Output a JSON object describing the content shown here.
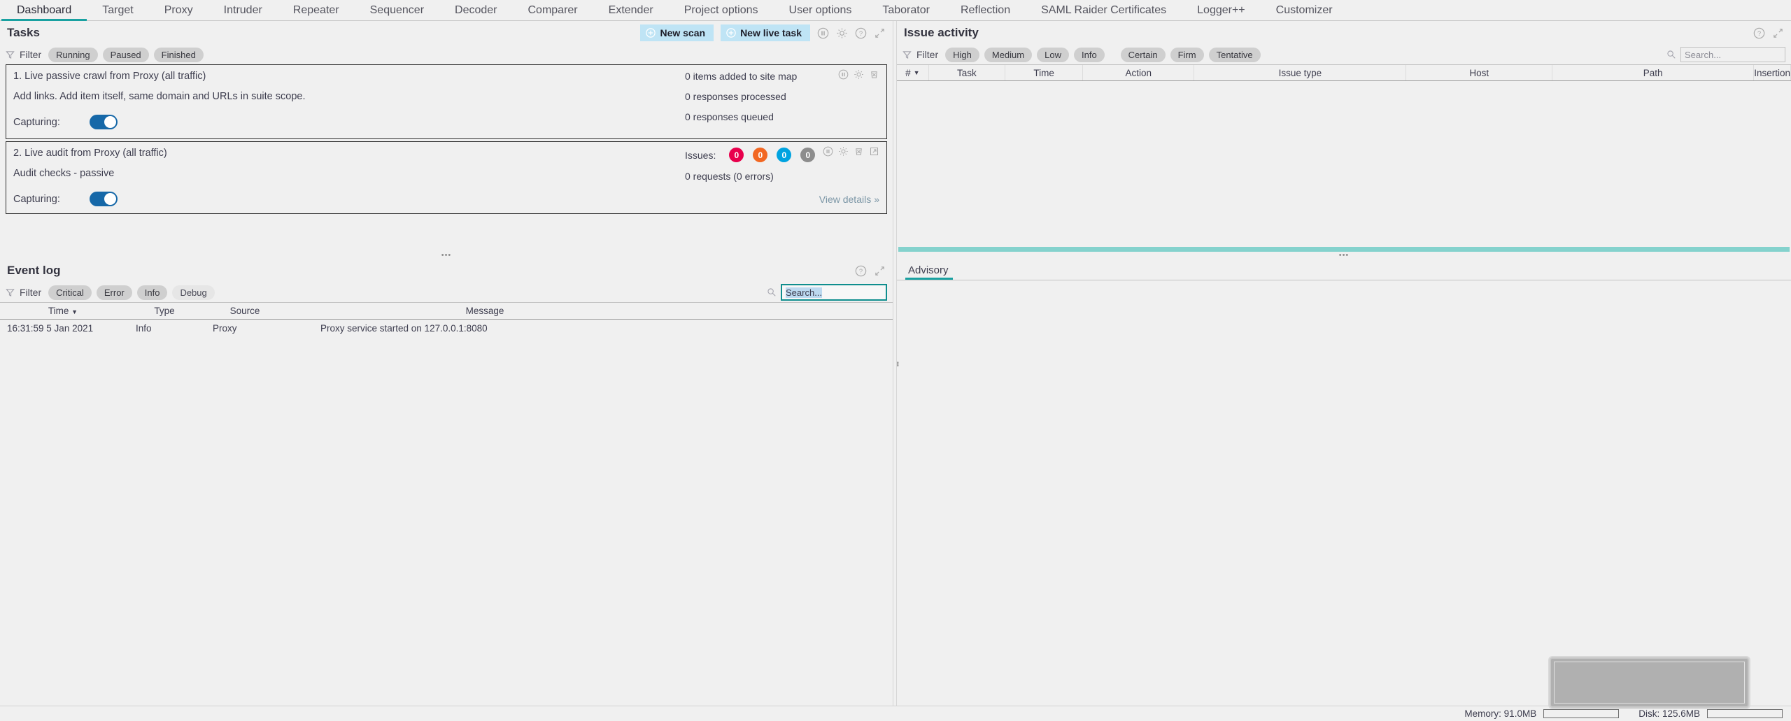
{
  "nav": {
    "tabs": [
      {
        "label": "Dashboard",
        "active": true
      },
      {
        "label": "Target",
        "active": false
      },
      {
        "label": "Proxy",
        "active": false
      },
      {
        "label": "Intruder",
        "active": false
      },
      {
        "label": "Repeater",
        "active": false
      },
      {
        "label": "Sequencer",
        "active": false
      },
      {
        "label": "Decoder",
        "active": false
      },
      {
        "label": "Comparer",
        "active": false
      },
      {
        "label": "Extender",
        "active": false
      },
      {
        "label": "Project options",
        "active": false
      },
      {
        "label": "User options",
        "active": false
      },
      {
        "label": "Taborator",
        "active": false
      },
      {
        "label": "Reflection",
        "active": false
      },
      {
        "label": "SAML Raider Certificates",
        "active": false
      },
      {
        "label": "Logger++",
        "active": false
      },
      {
        "label": "Customizer",
        "active": false
      }
    ]
  },
  "tasks": {
    "title": "Tasks",
    "new_scan_label": "New scan",
    "new_live_task_label": "New live task",
    "filter_label": "Filter",
    "filter_chips": [
      {
        "label": "Running",
        "on": true
      },
      {
        "label": "Paused",
        "on": true
      },
      {
        "label": "Finished",
        "on": true
      }
    ],
    "items": [
      {
        "title": "1. Live passive crawl from Proxy (all traffic)",
        "description": "Add links. Add item itself, same domain and URLs in suite scope.",
        "capturing_label": "Capturing:",
        "capturing_on": true,
        "stats": [
          "0 items added to site map",
          "0 responses processed",
          "0 responses queued"
        ],
        "icons": [
          "pause-icon",
          "gear-icon",
          "trash-icon"
        ],
        "has_issues": false,
        "has_view_details": false
      },
      {
        "title": "2. Live audit from Proxy (all traffic)",
        "description": "Audit checks - passive",
        "capturing_label": "Capturing:",
        "capturing_on": true,
        "issues_label": "Issues:",
        "issue_badges": [
          {
            "count": "0",
            "color": "#e8004c",
            "severity": "high"
          },
          {
            "count": "0",
            "color": "#f26722",
            "severity": "medium"
          },
          {
            "count": "0",
            "color": "#00a3e0",
            "severity": "low"
          },
          {
            "count": "0",
            "color": "#8d8d8d",
            "severity": "info"
          }
        ],
        "requests_text": "0 requests (0 errors)",
        "view_details_label": "View details",
        "icons": [
          "pause-icon",
          "gear-icon",
          "trash-icon",
          "popout-icon"
        ],
        "has_issues": true,
        "has_view_details": true
      }
    ]
  },
  "event_log": {
    "title": "Event log",
    "filter_label": "Filter",
    "filter_chips": [
      {
        "label": "Critical",
        "on": true
      },
      {
        "label": "Error",
        "on": true
      },
      {
        "label": "Info",
        "on": true
      },
      {
        "label": "Debug",
        "on": false
      }
    ],
    "search_value": "Search...",
    "search_focused": true,
    "columns": [
      "Time",
      "Type",
      "Source",
      "Message"
    ],
    "sort_column": "Time",
    "rows": [
      {
        "time": "16:31:59 5 Jan 2021",
        "type": "Info",
        "source": "Proxy",
        "message": "Proxy service started on 127.0.0.1:8080"
      }
    ]
  },
  "issue_activity": {
    "title": "Issue activity",
    "filter_label": "Filter",
    "severity_chips": [
      {
        "label": "High",
        "on": true
      },
      {
        "label": "Medium",
        "on": true
      },
      {
        "label": "Low",
        "on": true
      },
      {
        "label": "Info",
        "on": true
      }
    ],
    "confidence_chips": [
      {
        "label": "Certain",
        "on": true
      },
      {
        "label": "Firm",
        "on": true
      },
      {
        "label": "Tentative",
        "on": true
      }
    ],
    "search_placeholder": "Search...",
    "columns": [
      "#",
      "Task",
      "Time",
      "Action",
      "Issue type",
      "Host",
      "Path",
      "Insertion"
    ],
    "rows": []
  },
  "advisory": {
    "tabs": [
      {
        "label": "Advisory",
        "active": true
      }
    ],
    "content": ""
  },
  "status": {
    "memory_label": "Memory: 91.0MB",
    "disk_label": "Disk: 125.6MB"
  },
  "colors": {
    "accent_teal": "#19a1a1",
    "button_blue": "#bfe4f5",
    "toggle_blue": "#1668a8",
    "teal_bar": "#84d2cd"
  }
}
